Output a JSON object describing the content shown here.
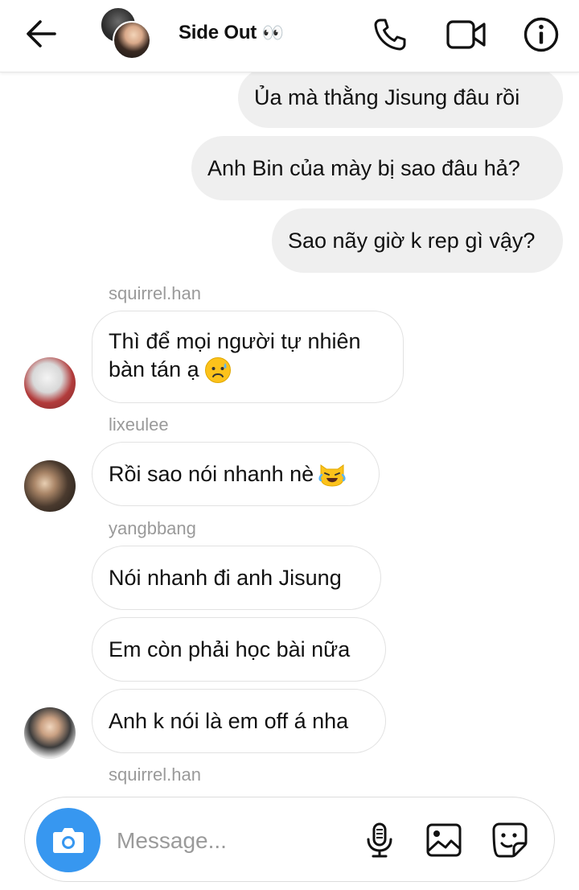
{
  "header": {
    "title": "Side Out",
    "title_emoji": "👀"
  },
  "messages": [
    {
      "direction": "outgoing",
      "text": "Ủa mà thằng Jisung đâu rồi"
    },
    {
      "direction": "outgoing",
      "text": "Anh Bin của mày bị sao đâu hả?"
    },
    {
      "direction": "outgoing",
      "text": "Sao nãy giờ k rep gì vậy?"
    },
    {
      "direction": "incoming",
      "sender": "squirrel.han",
      "lines": [
        "Thì để mọi người tự nhiên",
        "bàn tán ạ"
      ],
      "emoji": "sad-sweat-face"
    },
    {
      "direction": "incoming",
      "sender": "lixeulee",
      "text": "Rồi sao nói nhanh nè",
      "emoji": "crying-laughing-cat"
    },
    {
      "direction": "incoming",
      "sender": "yangbbang",
      "text": "Nói nhanh đi anh Jisung"
    },
    {
      "direction": "incoming",
      "text": "Em còn phải học bài nữa"
    },
    {
      "direction": "incoming",
      "text": "Anh k nói là em off á nha"
    }
  ],
  "typing_sender": "squirrel.han",
  "composer": {
    "placeholder": "Message..."
  },
  "colors": {
    "accent": "#3797f0",
    "outgoing_bubble": "#efefef",
    "incoming_border": "#e2e2e2",
    "sender_label": "#9a9a9a"
  },
  "icons": [
    "back-arrow-icon",
    "phone-icon",
    "video-camera-icon",
    "info-icon",
    "camera-icon",
    "microphone-icon",
    "gallery-icon",
    "sticker-icon"
  ]
}
